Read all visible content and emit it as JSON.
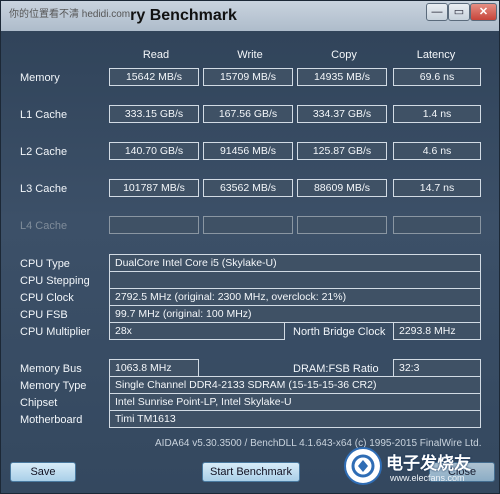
{
  "window": {
    "title": "ry Benchmark",
    "watermark": "你的位置看不清 hedidi.com",
    "min_label": "—",
    "max_label": "▭",
    "close_label": "✕"
  },
  "columns": [
    "Read",
    "Write",
    "Copy",
    "Latency"
  ],
  "rows": [
    {
      "label": "Memory",
      "values": [
        "15642 MB/s",
        "15709 MB/s",
        "14935 MB/s",
        "69.6 ns"
      ]
    },
    {
      "label": "L1 Cache",
      "values": [
        "333.15 GB/s",
        "167.56 GB/s",
        "334.37 GB/s",
        "1.4 ns"
      ]
    },
    {
      "label": "L2 Cache",
      "values": [
        "140.70 GB/s",
        "91456 MB/s",
        "125.87 GB/s",
        "4.6 ns"
      ]
    },
    {
      "label": "L3 Cache",
      "values": [
        "101787 MB/s",
        "63562 MB/s",
        "88609 MB/s",
        "14.7 ns"
      ]
    },
    {
      "label": "L4 Cache",
      "values": [
        "",
        "",
        "",
        ""
      ]
    }
  ],
  "cpu": {
    "type_label": "CPU Type",
    "type_value": "DualCore Intel Core i5  (Skylake-U)",
    "stepping_label": "CPU Stepping",
    "stepping_value": "",
    "clock_label": "CPU Clock",
    "clock_value": "2792.5 MHz  (original: 2300 MHz, overclock: 21%)",
    "fsb_label": "CPU FSB",
    "fsb_value": "99.7 MHz  (original: 100 MHz)",
    "multiplier_label": "CPU Multiplier",
    "multiplier_value": "28x",
    "nb_clock_label": "North Bridge Clock",
    "nb_clock_value": "2293.8 MHz"
  },
  "memory": {
    "bus_label": "Memory Bus",
    "bus_value": "1063.8 MHz",
    "ratio_label": "DRAM:FSB Ratio",
    "ratio_value": "32:3",
    "type_label": "Memory Type",
    "type_value": "Single Channel DDR4-2133 SDRAM  (15-15-15-36 CR2)",
    "chipset_label": "Chipset",
    "chipset_value": "Intel Sunrise Point-LP, Intel Skylake-U",
    "motherboard_label": "Motherboard",
    "motherboard_value": "Timi TM1613"
  },
  "footer": "AIDA64 v5.30.3500 / BenchDLL 4.1.643-x64  (c) 1995-2015 FinalWire Ltd.",
  "buttons": {
    "save": "Save",
    "start": "Start Benchmark",
    "close": "Close"
  },
  "logo": {
    "text": "电子发烧友",
    "sub": "www.elecfans.com"
  }
}
